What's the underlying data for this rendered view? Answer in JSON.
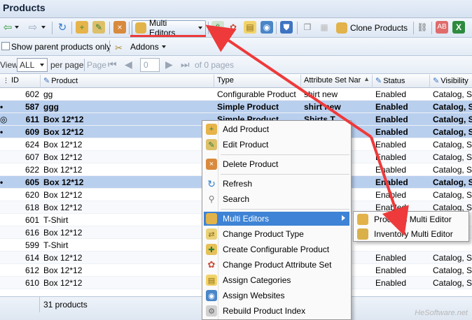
{
  "window": {
    "title": "Products"
  },
  "toolbar": {
    "multi_editors_label": "Multi Editors",
    "clone_products_label": "Clone Products"
  },
  "filter_bar": {
    "show_parent_label": "Show parent products only",
    "show_parent_checked": false,
    "addons_label": "Addons"
  },
  "pager": {
    "view_label": "View",
    "view_value": "ALL",
    "per_page_label": "per page",
    "page_label": "Page",
    "page_value": "0",
    "of_pages_text": "of 0 pages"
  },
  "columns": [
    "ID",
    "Product",
    "Type",
    "Attribute Set Nar",
    "Status",
    "Visibility"
  ],
  "rows": [
    {
      "id": "602",
      "product": "gg",
      "type": "Configurable Product",
      "attr_set": "shirt new",
      "status": "Enabled",
      "visibility": "Catalog, Sea",
      "state": "normal",
      "marker": ""
    },
    {
      "id": "587",
      "product": "ggg",
      "type": "Simple Product",
      "attr_set": "shirt new",
      "status": "Enabled",
      "visibility": "Catalog, Sea",
      "state": "selected",
      "marker": "•"
    },
    {
      "id": "611",
      "product": "Box 12*12",
      "type": "Simple Product",
      "attr_set": "Shirts T",
      "status": "Enabled",
      "visibility": "Catalog, Sea",
      "state": "selected",
      "marker": "◎"
    },
    {
      "id": "609",
      "product": "Box 12*12",
      "type": "",
      "attr_set": "",
      "status": "Enabled",
      "visibility": "Catalog, Sea",
      "state": "selected",
      "marker": "•"
    },
    {
      "id": "624",
      "product": "Box 12*12",
      "type": "",
      "attr_set": "",
      "status": "Enabled",
      "visibility": "Catalog, Sea",
      "state": "normal",
      "marker": ""
    },
    {
      "id": "607",
      "product": "Box 12*12",
      "type": "",
      "attr_set": "",
      "status": "Enabled",
      "visibility": "Catalog, Sea",
      "state": "normal",
      "marker": ""
    },
    {
      "id": "622",
      "product": "Box 12*12",
      "type": "",
      "attr_set": "",
      "status": "Enabled",
      "visibility": "Catalog, Sea",
      "state": "normal",
      "marker": ""
    },
    {
      "id": "605",
      "product": "Box 12*12",
      "type": "",
      "attr_set": "",
      "status": "Enabled",
      "visibility": "Catalog, Sea",
      "state": "selected",
      "marker": "•"
    },
    {
      "id": "620",
      "product": "Box 12*12",
      "type": "",
      "attr_set": "",
      "status": "Enabled",
      "visibility": "Catalog, Sea",
      "state": "normal",
      "marker": ""
    },
    {
      "id": "618",
      "product": "Box 12*12",
      "type": "",
      "attr_set": "",
      "status": "Enabled",
      "visibility": "Catalog, Sea",
      "state": "normal",
      "marker": ""
    },
    {
      "id": "601",
      "product": "T-Shirt",
      "type": "",
      "attr_set": "",
      "status": "",
      "visibility": "",
      "state": "normal",
      "marker": ""
    },
    {
      "id": "616",
      "product": "Box 12*12",
      "type": "",
      "attr_set": "",
      "status": "",
      "visibility": "",
      "state": "normal",
      "marker": ""
    },
    {
      "id": "599",
      "product": "T-Shirt",
      "type": "",
      "attr_set": "",
      "status": "",
      "visibility": "",
      "state": "normal",
      "marker": ""
    },
    {
      "id": "614",
      "product": "Box 12*12",
      "type": "",
      "attr_set": "",
      "status": "Enabled",
      "visibility": "Catalog, Sea",
      "state": "normal",
      "marker": ""
    },
    {
      "id": "612",
      "product": "Box 12*12",
      "type": "",
      "attr_set": "",
      "status": "Enabled",
      "visibility": "Catalog, Sea",
      "state": "normal",
      "marker": ""
    },
    {
      "id": "610",
      "product": "Box 12*12",
      "type": "",
      "attr_set": "",
      "status": "Enabled",
      "visibility": "Catalog, Sea",
      "state": "normal",
      "marker": ""
    }
  ],
  "statusbar": {
    "count_text": "31 products"
  },
  "context_menu": {
    "items": [
      {
        "label": "Add Product",
        "icon": "add-product-icon",
        "icon_color": "#d69a2c"
      },
      {
        "label": "Edit Product",
        "icon": "edit-product-icon",
        "icon_color": "#6aa84f"
      },
      {
        "label": "Delete Product",
        "icon": "delete-product-icon",
        "icon_color": "#cc6a2c"
      },
      {
        "label": "Refresh",
        "icon": "refresh-icon",
        "icon_color": "#3a7bd5"
      },
      {
        "label": "Search",
        "icon": "search-icon",
        "icon_color": "#7a7a7a"
      },
      {
        "label": "Multi Editors",
        "icon": "multi-editors-icon",
        "icon_color": "#d4a429"
      },
      {
        "label": "Change Product Type",
        "icon": "change-type-icon",
        "icon_color": "#c9a227"
      },
      {
        "label": "Create Configurable Product",
        "icon": "configurable-product-icon",
        "icon_color": "#c9a227"
      },
      {
        "label": "Change Product Attribute Set",
        "icon": "attribute-set-icon",
        "icon_color": "#c94d3a"
      },
      {
        "label": "Assign Categories",
        "icon": "categories-icon",
        "icon_color": "#e2b53a"
      },
      {
        "label": "Assign Websites",
        "icon": "websites-icon",
        "icon_color": "#4a86c8"
      },
      {
        "label": "Rebuild Product Index",
        "icon": "rebuild-index-icon",
        "icon_color": "#aaaaaa"
      }
    ]
  },
  "submenu": {
    "items": [
      {
        "label": "Products Multi Editor",
        "icon": "products-multi-editor-icon"
      },
      {
        "label": "Inventory Multi Editor",
        "icon": "inventory-multi-editor-icon"
      }
    ]
  },
  "watermark": "HeSoftware.net",
  "colors": {
    "highlight": "#3e83d5",
    "selected_row": "#b9cfee",
    "annotation_arrow": "#ee3a3a"
  }
}
